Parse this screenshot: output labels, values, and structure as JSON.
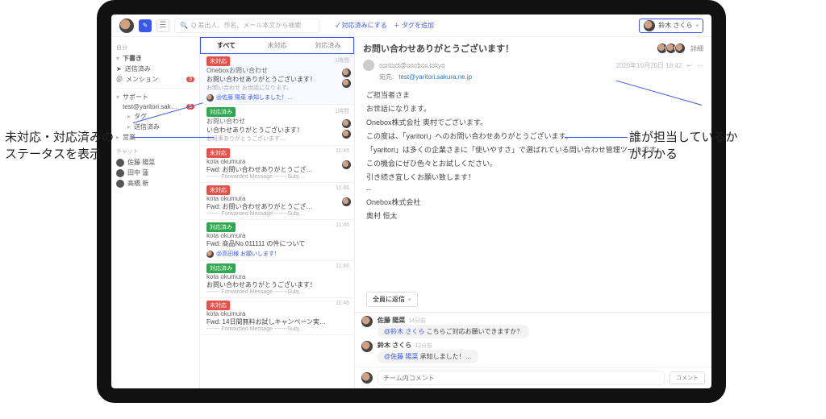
{
  "topbar": {
    "search_placeholder": "Q 差出人、作名、メール本文から検索",
    "mark_done": "✓ 対応済みにする",
    "add_tag": "＋ タグを追加",
    "assignee": "鈴木 さくら"
  },
  "sidebar": {
    "sec_self": "自分",
    "items_self": [
      {
        "label": "下書き",
        "bold": true,
        "has_caret": true
      },
      {
        "label": "送信済み",
        "icon": "➤"
      },
      {
        "label": "メンション",
        "icon": "＠",
        "num": "3",
        "badge": true
      }
    ],
    "other_group": "サポート",
    "other_item": "test@yaritori.sak…",
    "other_children": [
      {
        "label": "タグ",
        "caret": "▸"
      },
      {
        "label": "送信済み",
        "caret": "▸"
      }
    ],
    "other_badge": "5",
    "sales": "営業",
    "sec_chat": "チャット",
    "chat_members": [
      "佐藤 陽菜",
      "田中 蓮",
      "高橋 新"
    ]
  },
  "tabs": {
    "all": "すべて",
    "open": "未対応",
    "done": "対応済み"
  },
  "mails": [
    {
      "status": "未対応",
      "from": "Oneboxお問い合わせ <contact@…",
      "subj": "お問い合わせありがとうございます！",
      "preview": "お問い合わせ お世話になります。",
      "time": "1時間",
      "footmsg": "@佐藤 陽菜 承知しました！…",
      "assigned": 2,
      "state": "unresolved",
      "active": true
    },
    {
      "status": "対応済み",
      "from": "お問い合わせ <contact@…",
      "subj": "い合わせありがとうございます！",
      "preview": "お返事ありがとうございます…",
      "time": "1時間",
      "footmsg": "",
      "assigned": 2,
      "state": "resolved"
    },
    {
      "status": "未対応",
      "from": "kota okumura <test@yaritori.sa…",
      "subj": "Fwd: お問い合わせありがとうござ…",
      "preview": "------- Forwarded Message -------Subj…",
      "time": "11:46",
      "footmsg": "",
      "assigned": 1,
      "state": "unresolved"
    },
    {
      "status": "未対応",
      "from": "kota okumura <test@yaritori.sa…",
      "subj": "Fwd: お問い合わせありがとうござ…",
      "preview": "------- Forwarded Message -------Subj…",
      "time": "11:46",
      "footmsg": "",
      "assigned": 1,
      "state": "unresolved"
    },
    {
      "status": "対応済み",
      "from": "kota okumura <test@yaritori.sa…",
      "subj": "Fwd: 商品No.011111 の件について",
      "preview": "",
      "time": "11:46",
      "footmsg": "@高田様 お願いします！",
      "assigned": 0,
      "state": "resolved"
    },
    {
      "status": "対応済み",
      "from": "kota okumura <test@yaritori.sa…",
      "subj": "お問い合わせありがとうございます！",
      "preview": "------- Forwarded Message -------Subj…",
      "time": "11:46",
      "footmsg": "",
      "assigned": 0,
      "state": "resolved"
    },
    {
      "status": "未対応",
      "from": "kota okumura <test@yaritori.…",
      "subj": "Fwd: 14日間無料お試しキャンペーン実…",
      "preview": "------- Forwarded Message -------Subj…",
      "time": "11:46",
      "footmsg": "",
      "assigned": 0,
      "state": "unresolved"
    }
  ],
  "detail": {
    "subject": "お問い合わせありがとうございます！",
    "detail_label": "詳細",
    "from_name": "contact@onebox.tokyo",
    "to_label": "宛先:",
    "to": "test@yaritori.sakura.ne.jp",
    "time": "2020年10月20日 18:42",
    "body": [
      "ご担当者さま",
      "お世話になります。",
      "Onebox株式会社 奥村でございます。",
      "この度は、「yaritori」へのお問い合わせありがとうございます。",
      "「yaritori」は多くの企業さまに「使いやすさ」で選ばれている問い合わせ管理ツールです。",
      "この機会にぜひ色々とお試しください。",
      "引き続き宜しくお願い致します！",
      "--",
      "Onebox株式会社",
      "奥村 恒太"
    ],
    "reply_all": "全員に返信"
  },
  "comments": [
    {
      "author": "佐藤 陽菜",
      "ts": "14分前",
      "mention": "@鈴木 さくら",
      "text": "こちらご対応お願いできますか？"
    },
    {
      "author": "鈴木 さくら",
      "ts": "12分前",
      "mention": "@佐藤 陽菜",
      "text": "承知しました！…"
    }
  ],
  "comment_input": {
    "placeholder": "チーム内コメント",
    "send": "コメント"
  },
  "callouts": {
    "left": "未対応・対応済みの\nステータスを表示",
    "right": "誰が担当しているか\nがわかる"
  }
}
